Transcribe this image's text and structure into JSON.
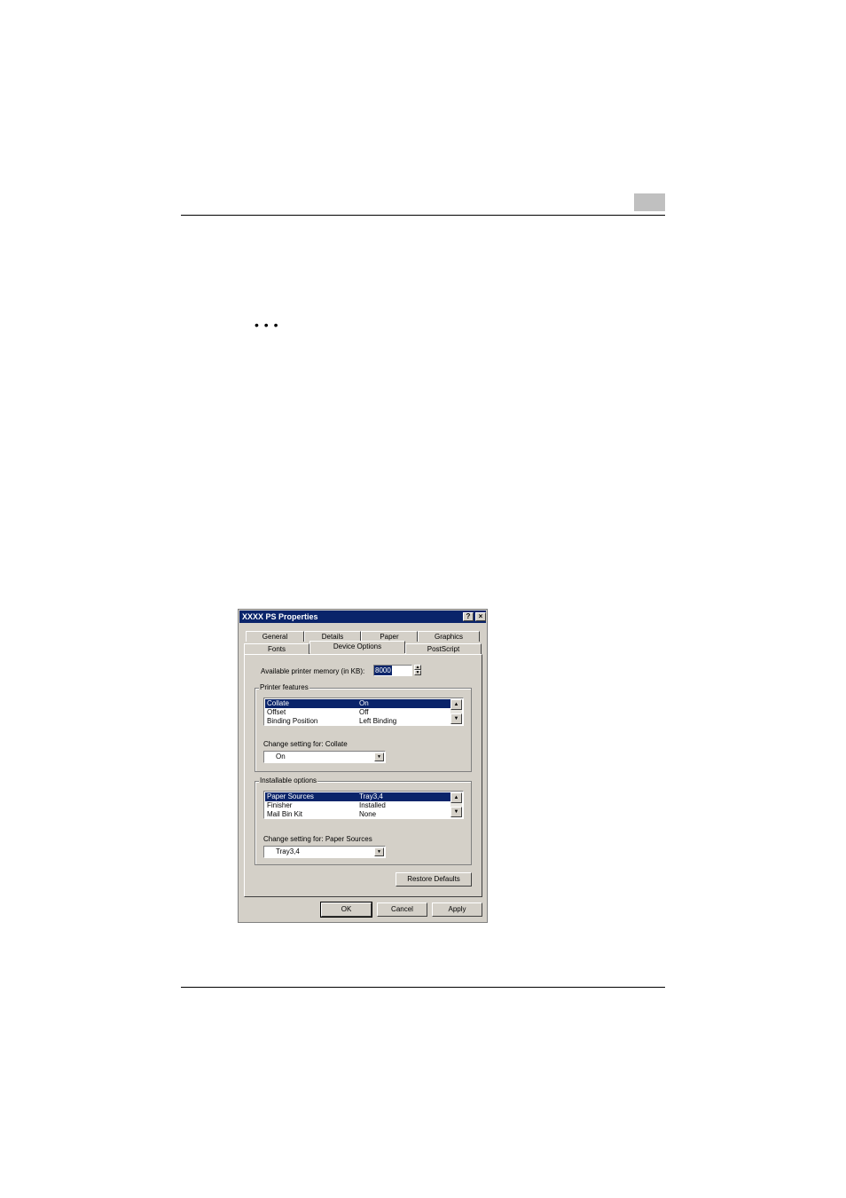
{
  "dialog": {
    "title": "XXXX PS Properties",
    "help_button": "?",
    "close_button": "×",
    "tabs_back": [
      "General",
      "Details",
      "Paper",
      "Graphics"
    ],
    "tabs_front": [
      "Fonts",
      "Device Options",
      "PostScript"
    ],
    "active_tab": "Device Options",
    "memory": {
      "label": "Available printer memory (in KB):",
      "value": "8000"
    },
    "printer_features": {
      "title": "Printer features",
      "rows": [
        {
          "name": "Collate",
          "value": "On"
        },
        {
          "name": "Offset",
          "value": "Off"
        },
        {
          "name": "Binding Position",
          "value": "Left Binding"
        }
      ],
      "change_label": "Change setting for:  Collate",
      "selected_value": "On"
    },
    "installable_options": {
      "title": "Installable options",
      "rows": [
        {
          "name": "Paper Sources",
          "value": "Tray3,4"
        },
        {
          "name": "Finisher",
          "value": "Installed"
        },
        {
          "name": "Mail Bin Kit",
          "value": "None"
        }
      ],
      "change_label": "Change setting for:  Paper Sources",
      "selected_value": "Tray3,4"
    },
    "restore_defaults": "Restore Defaults",
    "ok": "OK",
    "cancel": "Cancel",
    "apply": "Apply"
  },
  "page": {
    "ellipsis": "• • •"
  }
}
